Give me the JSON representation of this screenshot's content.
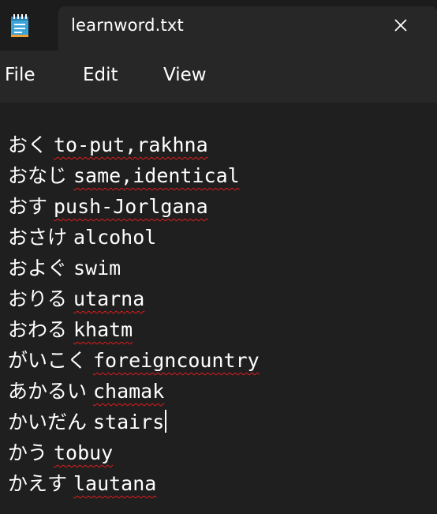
{
  "window": {
    "tab_title": "learnword.txt",
    "close_glyph": "✕",
    "app_icon": "notepad-icon"
  },
  "menu": {
    "items": [
      "File",
      "Edit",
      "View"
    ]
  },
  "editor": {
    "lines": [
      {
        "jp": "おく",
        "word": "to-put,rakhna"
      },
      {
        "jp": "おなじ",
        "word": "same,identical"
      },
      {
        "jp": "おす",
        "word": "push-Jorlgana"
      },
      {
        "jp": "おさけ",
        "word": "alcohol"
      },
      {
        "jp": "およぐ",
        "word": "swim"
      },
      {
        "jp": "おりる",
        "word": "utarna"
      },
      {
        "jp": "おわる",
        "word": "khatm"
      },
      {
        "jp": "がいこく",
        "word": "foreigncountry"
      },
      {
        "jp": "あかるい",
        "word": "chamak"
      },
      {
        "jp": "かいだん",
        "word": "stairs"
      },
      {
        "jp": "かう",
        "word": "tobuy"
      },
      {
        "jp": "かえす",
        "word": "lautana"
      }
    ],
    "colors": {
      "background": "#1f1f1f",
      "text": "#ffffff",
      "spellcheck_underline": "#e01b1b"
    }
  }
}
